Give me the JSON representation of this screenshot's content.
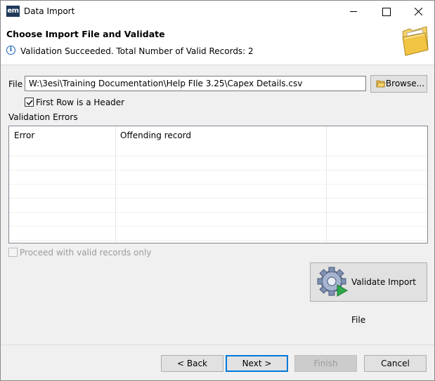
{
  "window": {
    "title": "Data Import",
    "app_icon_text": "em"
  },
  "header": {
    "title": "Choose Import File and Validate",
    "status": "Validation Succeeded. Total Number of Valid Records: 2"
  },
  "file": {
    "label": "File",
    "value": "W:\\3esi\\Training Documentation\\Help FIle 3.25\\Capex Details.csv",
    "browse_label": "Browse..."
  },
  "first_row_header": {
    "label": "First Row is a Header",
    "checked": true
  },
  "validation_errors": {
    "label": "Validation Errors",
    "columns": [
      "Error",
      "Offending record"
    ],
    "rows": []
  },
  "proceed_valid_only": {
    "label": "Proceed with valid records only",
    "checked": false,
    "enabled": false
  },
  "validate_button": {
    "label": "Validate Import File"
  },
  "footer": {
    "back": "< Back",
    "next": "Next >",
    "finish": "Finish",
    "cancel": "Cancel"
  },
  "icons": {
    "app": "em-app-icon",
    "info": "info-icon",
    "header": "folder-icon",
    "browse": "browse-folder-icon",
    "validate": "gear-play-icon"
  },
  "colors": {
    "accent": "#0078d7",
    "info": "#1a5fb4"
  }
}
